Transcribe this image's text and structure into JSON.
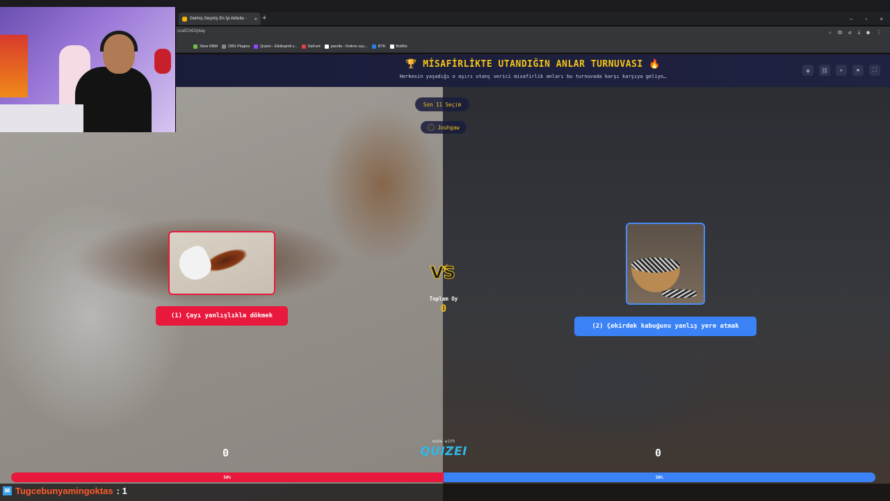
{
  "browser": {
    "tab_title": "Gelmiş Geçmiş En İyi Aktivite -",
    "tab_close": "×",
    "new_tab": "+",
    "url": "ccaf2342/play",
    "window_controls": [
      "–",
      "▫",
      "×"
    ],
    "bookmarks": [
      {
        "label": "Xbox KBM",
        "color": "#6cc04a"
      },
      {
        "label": "OBS Plugins",
        "color": "#888888"
      },
      {
        "label": "Quizei - Etkileşimli v...",
        "color": "#9147ff"
      },
      {
        "label": "DaFont",
        "color": "#e04040"
      },
      {
        "label": "parolla - Kelime oyu...",
        "color": "#ffffff"
      },
      {
        "label": "BTK",
        "color": "#2a7de1"
      },
      {
        "label": "BotRix",
        "color": "#ffffff"
      }
    ]
  },
  "header": {
    "title": "🏆 MİSAFİRLİKTE UTANDIĞIN ANLAR TURNUVASI 🔥",
    "subtitle": "Herkesin yaşadığı o aşırı utanç verici misafirlik anları bu turnuvada karşı karşıya geliyo…",
    "icons": [
      "eye-icon",
      "link-icon",
      "send-icon",
      "flag-icon",
      "fullscreen-icon"
    ],
    "icon_glyphs": [
      "◉",
      "⛓",
      "➤",
      "⚑",
      "⛶"
    ]
  },
  "round": {
    "label": "Son 11 Seçim",
    "user": "Jouhgaw"
  },
  "options": {
    "left": {
      "label": "(1) Çayı yanlışlıkla dökmek",
      "votes": "0",
      "percent": "50%",
      "color": "#e8193c"
    },
    "right": {
      "label": "(2) Çekirdek kabuğunu yanlış yere atmak",
      "votes": "0",
      "percent": "50%",
      "color": "#3b82f6"
    }
  },
  "center": {
    "total_label": "Toplam Oy",
    "total_value": "0"
  },
  "footer": {
    "made_with": "made with",
    "brand": "QUIZEI"
  },
  "chat": {
    "username": "Tugcebunyamingoktas",
    "value": ": 1"
  }
}
